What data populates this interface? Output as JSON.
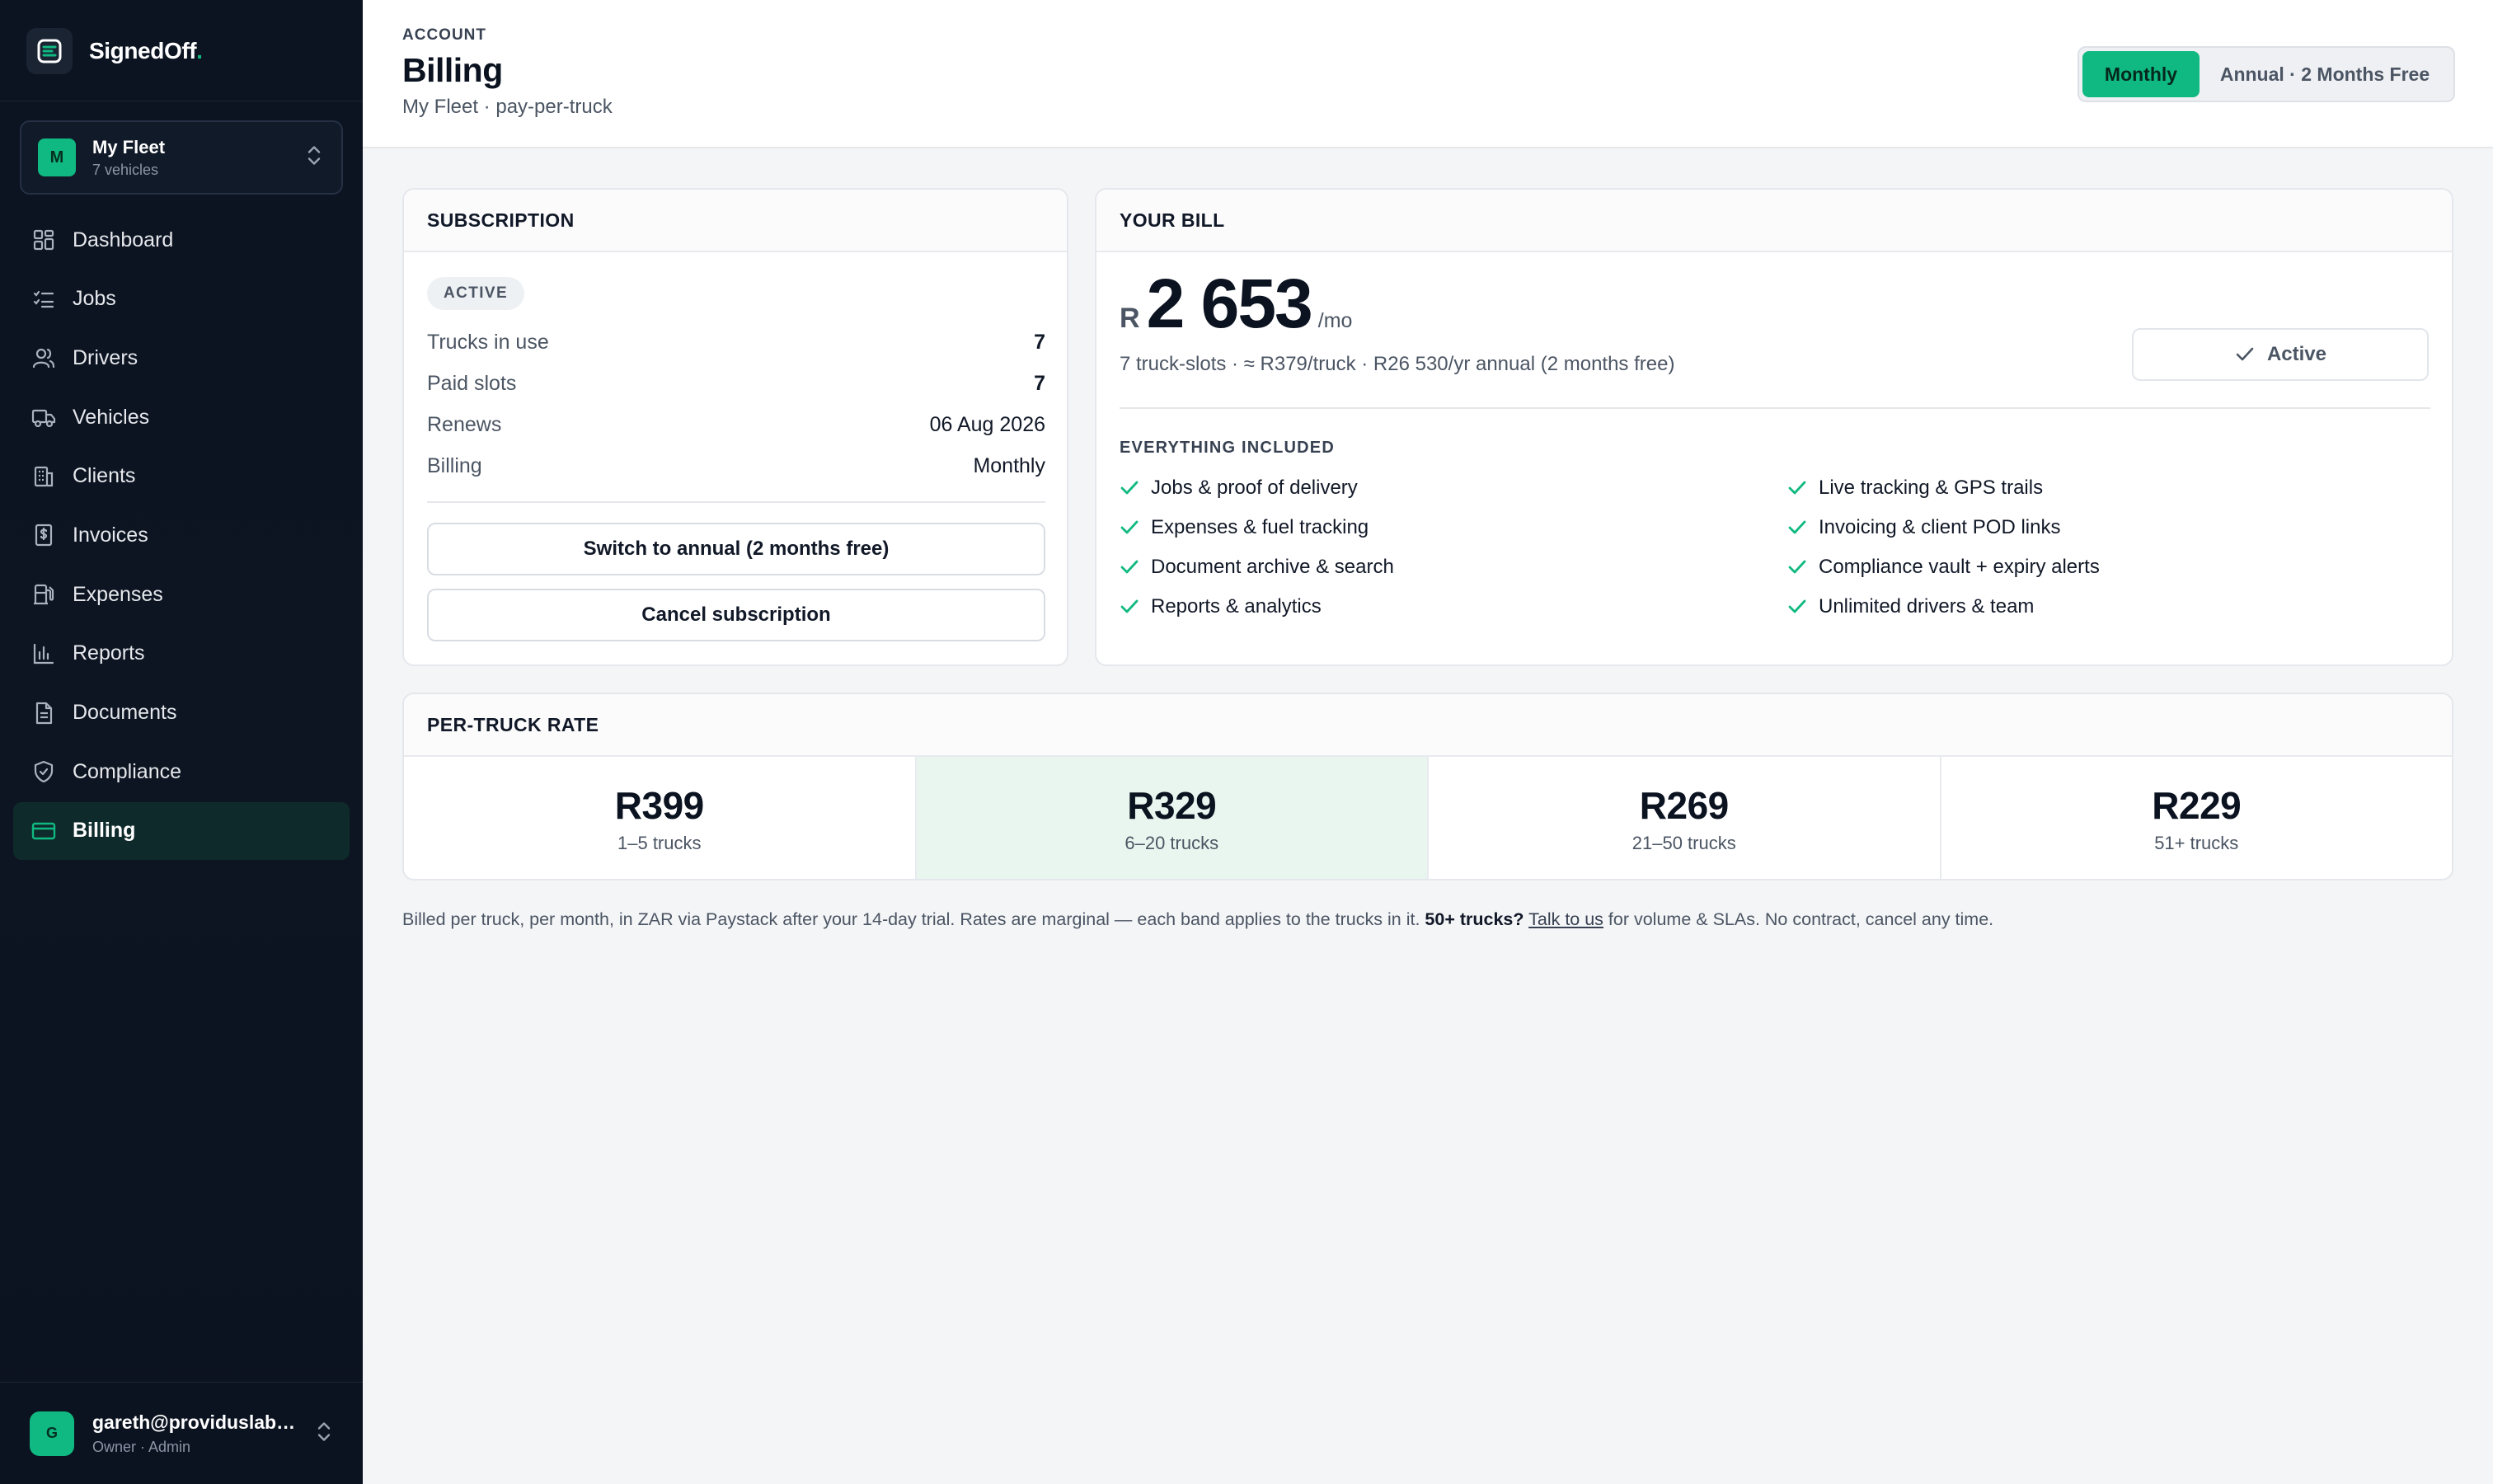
{
  "brand": {
    "name": "SignedOff",
    "dot": "."
  },
  "fleet": {
    "initial": "M",
    "name": "My Fleet",
    "subtitle": "7 vehicles"
  },
  "nav": [
    {
      "label": "Dashboard",
      "icon": "dashboard-icon"
    },
    {
      "label": "Jobs",
      "icon": "jobs-icon"
    },
    {
      "label": "Drivers",
      "icon": "drivers-icon"
    },
    {
      "label": "Vehicles",
      "icon": "truck-icon"
    },
    {
      "label": "Clients",
      "icon": "building-icon"
    },
    {
      "label": "Invoices",
      "icon": "invoice-icon"
    },
    {
      "label": "Expenses",
      "icon": "fuel-icon"
    },
    {
      "label": "Reports",
      "icon": "bar-chart-icon"
    },
    {
      "label": "Documents",
      "icon": "document-icon"
    },
    {
      "label": "Compliance",
      "icon": "shield-icon"
    },
    {
      "label": "Billing",
      "icon": "credit-card-icon",
      "active": true
    }
  ],
  "user": {
    "initial": "G",
    "email": "gareth@providuslabs.com",
    "role": "Owner · Admin"
  },
  "header": {
    "eyebrow": "ACCOUNT",
    "title": "Billing",
    "subtitle": "My Fleet · pay-per-truck",
    "toggle": {
      "monthly": "Monthly",
      "annual": "Annual · 2 Months Free",
      "selected": "Monthly"
    }
  },
  "subscription": {
    "title": "SUBSCRIPTION",
    "status": "ACTIVE",
    "rows": [
      {
        "label": "Trucks in use",
        "value": "7"
      },
      {
        "label": "Paid slots",
        "value": "7"
      },
      {
        "label": "Renews",
        "value": "06 Aug 2026"
      },
      {
        "label": "Billing",
        "value": "Monthly"
      }
    ],
    "switch_button": "Switch to annual (2 months free)",
    "cancel_button": "Cancel subscription"
  },
  "bill": {
    "title": "YOUR BILL",
    "currency": "R",
    "amount": "2 653",
    "period": "/mo",
    "detail": "7 truck-slots · ≈ R379/truck · R26 530/yr annual (2 months free)",
    "status": "Active",
    "included_title": "EVERYTHING INCLUDED",
    "features": [
      "Jobs & proof of delivery",
      "Live tracking & GPS trails",
      "Expenses & fuel tracking",
      "Invoicing & client POD links",
      "Document archive & search",
      "Compliance vault + expiry alerts",
      "Reports & analytics",
      "Unlimited drivers & team"
    ]
  },
  "rates": {
    "title": "PER-TRUCK RATE",
    "tiers": [
      {
        "price": "R399",
        "range": "1–5 trucks"
      },
      {
        "price": "R329",
        "range": "6–20 trucks",
        "current": true
      },
      {
        "price": "R269",
        "range": "21–50 trucks"
      },
      {
        "price": "R229",
        "range": "51+ trucks"
      }
    ]
  },
  "footnote": {
    "text_before": "Billed per truck, per month, in ZAR via Paystack after your 14-day trial. Rates are marginal — each band applies to the trucks in it. ",
    "bold": "50+ trucks?",
    "link": "Talk to us",
    "text_after": " for volume & SLAs. No contract, cancel any time."
  },
  "colors": {
    "accent": "#10b981",
    "sidebar": "#0c1422",
    "current_tier": "#e8f6ef"
  }
}
